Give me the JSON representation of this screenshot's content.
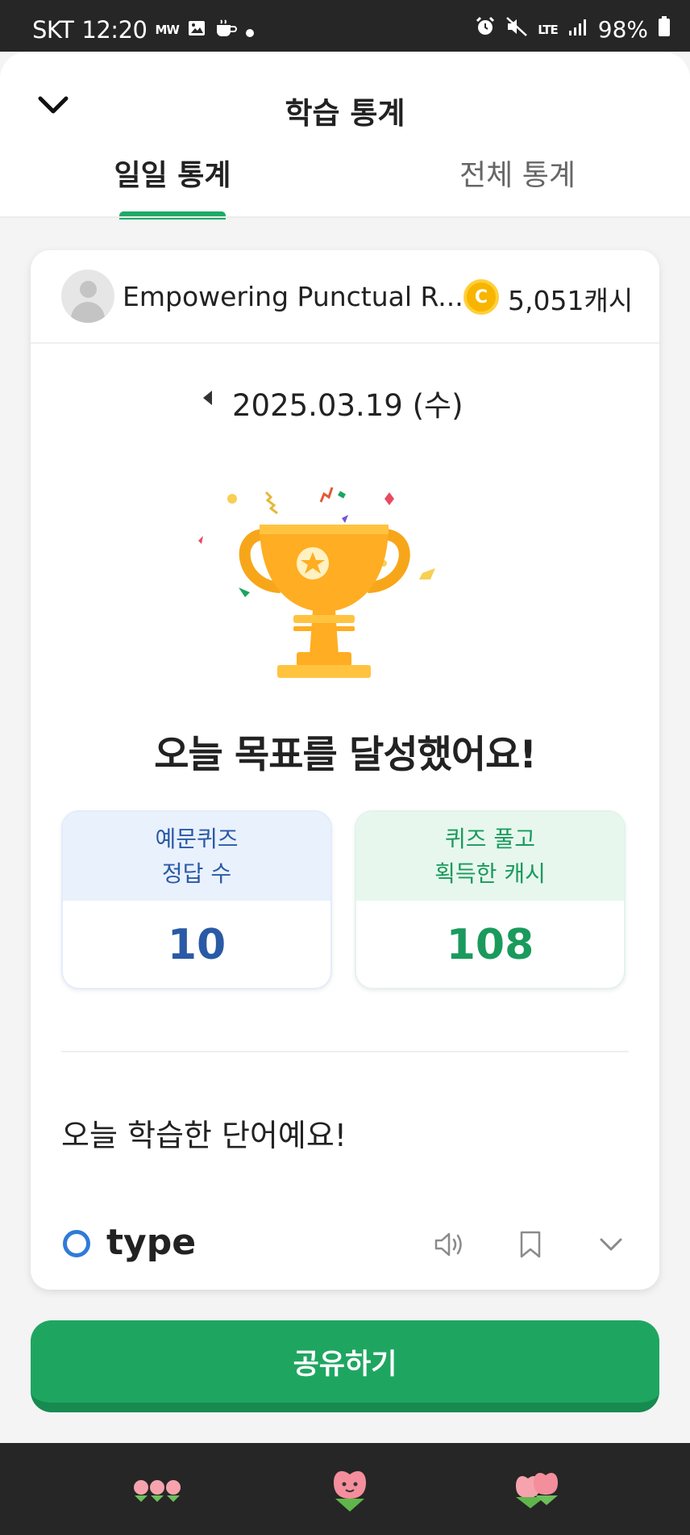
{
  "status_bar": {
    "carrier": "SKT",
    "time": "12:20",
    "mw": "MW",
    "network": "LTE",
    "battery": "98%"
  },
  "header": {
    "title": "학습 통계",
    "tabs": [
      {
        "label": "일일 통계",
        "active": true
      },
      {
        "label": "전체 통계",
        "active": false
      }
    ]
  },
  "profile": {
    "name": "Empowering Punctual R...",
    "cash": "5,051캐시"
  },
  "date": "2025.03.19 (수)",
  "achievement": "오늘 목표를 달성했어요!",
  "stats": [
    {
      "label_line1": "예문퀴즈",
      "label_line2": "정답 수",
      "value": "10"
    },
    {
      "label_line1": "퀴즈 풀고",
      "label_line2": "획득한 캐시",
      "value": "108"
    }
  ],
  "words_section": {
    "title": "오늘 학습한 단어예요!",
    "items": [
      {
        "word": "type"
      }
    ]
  },
  "share_button": "공유하기",
  "colors": {
    "accent_green": "#1ea661",
    "stat_blue": "#2a5aa6",
    "stat_green": "#1a9a5c",
    "ring_blue": "#2f7bd8",
    "coin": "#f7b500",
    "trophy": "#ffab1f"
  }
}
